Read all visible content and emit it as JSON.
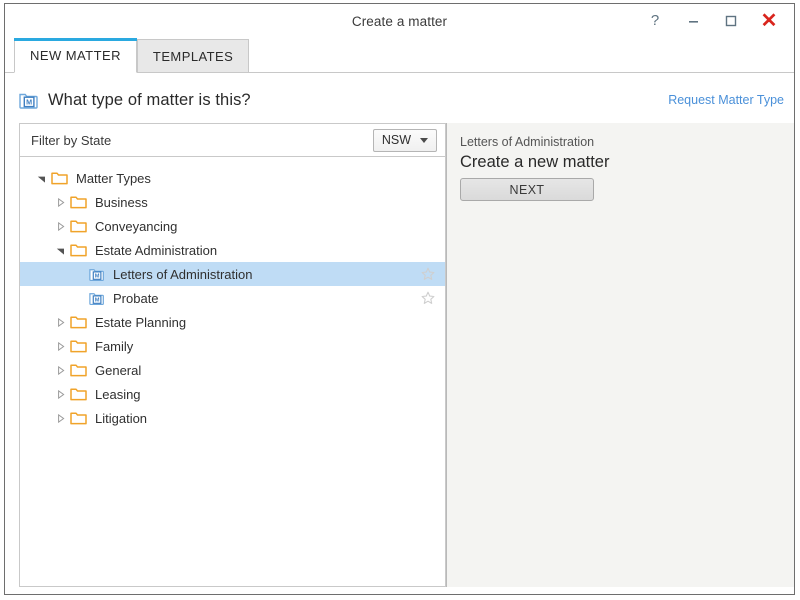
{
  "window": {
    "title": "Create a matter",
    "controls": {
      "help": "?",
      "minimize": "–",
      "maximize": "□",
      "close": "✕"
    }
  },
  "tabs": [
    {
      "label": "NEW MATTER",
      "active": true
    },
    {
      "label": "TEMPLATES",
      "active": false
    }
  ],
  "header": {
    "icon": "matter-type-icon",
    "title": "What type of matter is this?",
    "request_link": "Request Matter Type"
  },
  "filter": {
    "label": "Filter by State",
    "state_value": "NSW",
    "caret": "chevron-down-icon"
  },
  "tree": [
    {
      "label": "Matter Types",
      "depth": 0,
      "kind": "folder",
      "expanded": true,
      "selected": false,
      "star": false
    },
    {
      "label": "Business",
      "depth": 1,
      "kind": "folder",
      "expanded": false,
      "selected": false,
      "star": false
    },
    {
      "label": "Conveyancing",
      "depth": 1,
      "kind": "folder",
      "expanded": false,
      "selected": false,
      "star": false
    },
    {
      "label": "Estate Administration",
      "depth": 1,
      "kind": "folder",
      "expanded": true,
      "selected": false,
      "star": false
    },
    {
      "label": "Letters of Administration",
      "depth": 2,
      "kind": "matter-type",
      "expanded": null,
      "selected": true,
      "star": true
    },
    {
      "label": "Probate",
      "depth": 2,
      "kind": "matter-type",
      "expanded": null,
      "selected": false,
      "star": true
    },
    {
      "label": "Estate Planning",
      "depth": 1,
      "kind": "folder",
      "expanded": false,
      "selected": false,
      "star": false
    },
    {
      "label": "Family",
      "depth": 1,
      "kind": "folder",
      "expanded": false,
      "selected": false,
      "star": false
    },
    {
      "label": "General",
      "depth": 1,
      "kind": "folder",
      "expanded": false,
      "selected": false,
      "star": false
    },
    {
      "label": "Leasing",
      "depth": 1,
      "kind": "folder",
      "expanded": false,
      "selected": false,
      "star": false
    },
    {
      "label": "Litigation",
      "depth": 1,
      "kind": "folder",
      "expanded": false,
      "selected": false,
      "star": false
    }
  ],
  "detail": {
    "subtitle": "Letters of Administration",
    "title": "Create a new matter",
    "next_label": "NEXT"
  },
  "colors": {
    "accent_blue": "#2aa9e0",
    "link_blue": "#4a90d9",
    "selection_blue": "#bfdcf5",
    "folder_orange": "#f0a32a",
    "close_red": "#d9251d",
    "panel_grey": "#f4f4f2"
  }
}
